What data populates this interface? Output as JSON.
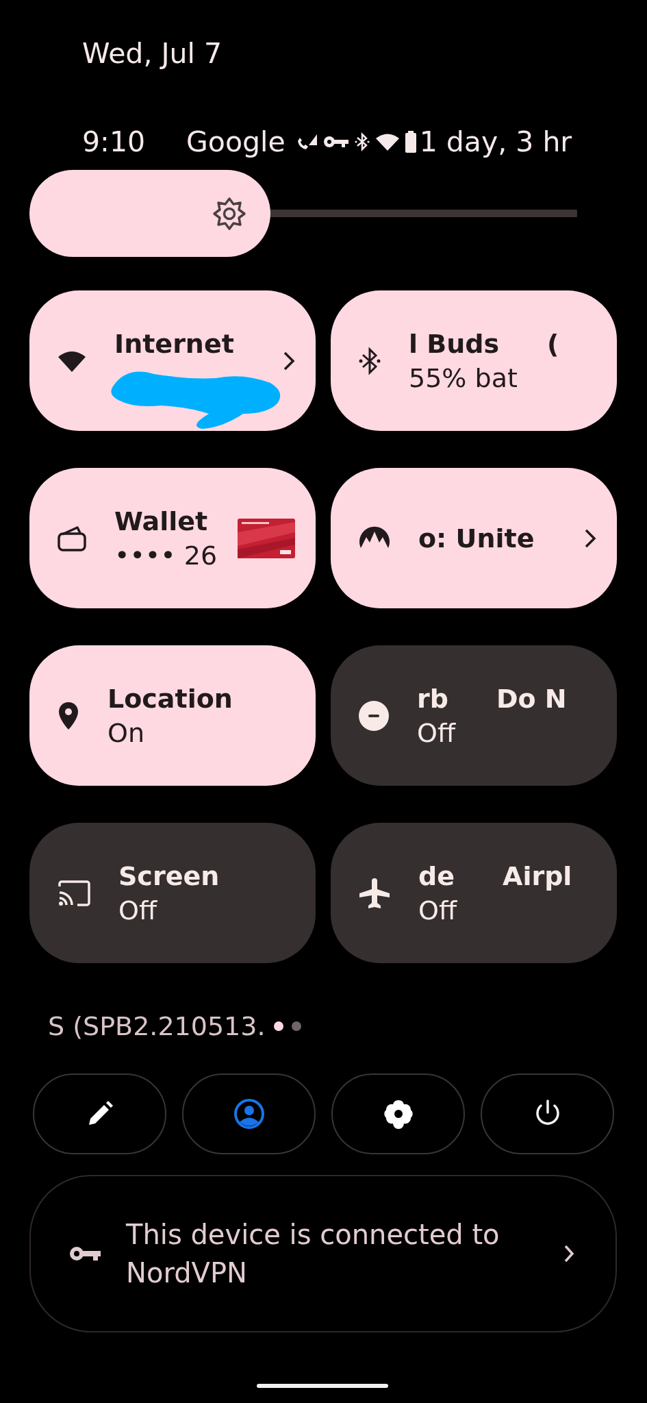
{
  "header": {
    "date": "Wed, Jul 7"
  },
  "status_bar": {
    "time": "9:10",
    "carrier": "Google",
    "battery_text": "1 day, 3 hr"
  },
  "brightness": {
    "level": 0.44
  },
  "tiles": [
    {
      "kind": "internet",
      "label": [
        "Internet"
      ],
      "active": true,
      "chevron": true,
      "redacted": true
    },
    {
      "kind": "bluetooth",
      "label": [
        "l Buds",
        "("
      ],
      "subtitle": "55% bat",
      "active": true
    },
    {
      "kind": "wallet",
      "label": [
        "Wallet"
      ],
      "subtitle": "•••• 26",
      "active": true,
      "card": {
        "kind": "picture"
      }
    },
    {
      "kind": "vpn",
      "label": [
        "o: Unite"
      ],
      "active": true,
      "chevron": true
    },
    {
      "kind": "location",
      "label": [
        "Location"
      ],
      "subtitle": "On",
      "active": true
    },
    {
      "kind": "dnd",
      "label": [
        "rb",
        "Do N"
      ],
      "subtitle": "Off",
      "active": false
    },
    {
      "kind": "cast",
      "label": [
        "Screen"
      ],
      "subtitle": "Off",
      "active": false
    },
    {
      "kind": "airplane",
      "label": [
        "de",
        "Airpl"
      ],
      "subtitle": "Off",
      "active": false
    }
  ],
  "build": {
    "text": "S (SPB2.210513.",
    "pages": [
      {
        "selected": true
      },
      {
        "selected": false
      }
    ]
  },
  "footer_buttons": [
    {
      "kind": "edit"
    },
    {
      "kind": "user"
    },
    {
      "kind": "settings"
    },
    {
      "kind": "power"
    }
  ],
  "vpn_notice": {
    "text": "This device is connected to NordVPN",
    "chevron": true
  }
}
